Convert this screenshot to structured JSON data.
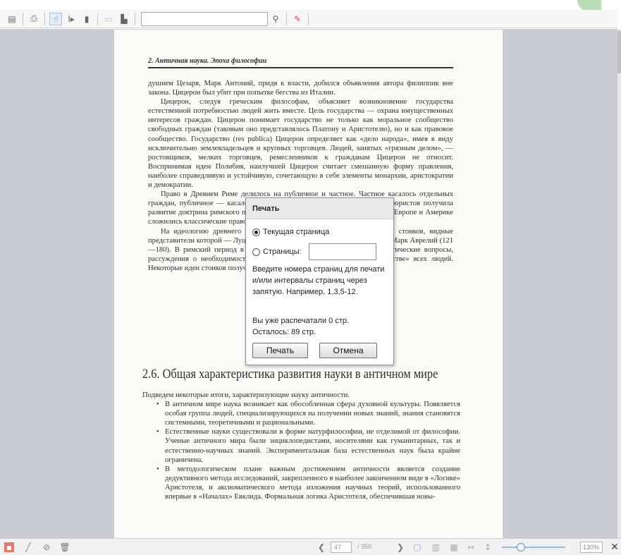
{
  "toolbar": {
    "buttons": [
      "sidebar-icon",
      "print-icon",
      "select-tool-icon",
      "text-select-icon",
      "page-icon",
      "copy-icon",
      "bookmark-icon"
    ],
    "search_icon": "search-icon",
    "highlight_icon": "highlight-icon"
  },
  "page": {
    "running_head": "2. Античная наука. Эпоха философии",
    "paragraphs": [
      "душием Цезаря, Марк Антоний, придя к власти, добился объявления автора филиппик вне закона. Цицерон был убит при попытке бегства из Италии.",
      "Цицерон, следуя греческим философам, объясняет возникновение государства естественной потребностью людей жить вместе. Цель государства — охрана имущественных интересов граждан. Цицерон понимает государство не только как моральное сообщество свободных граждан (таковым оно представлялось Платону и Аристотелю), но и как правовое сообщество. Государство (res publica) Цицерон определяет как «дело народа», имея в виду исключительно землевладельцев и крупных торговцев. Людей, занятых «грязным делом», — ростовщиков, мелких торговцев, ремесленников к гражданам Цицерон не относит. Воспринимая идеи Полибия, наилучшей Цицерон считает смешанную форму правления, наиболее справедливую и устойчивую, сочетающую в себе элементы монархии, аристократии и демократии.",
      "Право в Древнем Риме делилось на публичное и частное. Частное касалось отдельных граждан, публичное — касалось государства в целом. В трудах римских юристов получила развитие доктрина римского права — цивилистики. Позднее на её основе в Европе и Америке сложились классические правовые системы.",
      "На идеологию древнего Рима огромное влияние оказала философия стоиков, видные представители которой — Луций Анней Сенека (ок. 4 г. до н.э. — 65 н.э.) и Марк Аврелий (121—180). В римский период в учении стоиков на первый план выходят этические вопросы, рассуждения о необходимости подчинения судьбе, о «мировом гражданстве» всех людей. Некоторые идеи стоиков получили развитие в христианстве."
    ],
    "section_title": "2.6. Общая характеристика развития науки в античном мире",
    "intro": "Подведем некоторые итоги, характеризующие науку античности.",
    "bullets": [
      "В античном мире наука возникает как обособленная сфера духовной культуры. Появляется особая группа людей, специализирующихся на получении новых знаний, знания становятся системными, теоретичными и рациональными.",
      "Естественные науки существовали в форме натурфилософии, не отделимой от философии. Ученые античного мира были энциклопедистами, носителями как гуманитарных, так и естественно-научных знаний. Экспериментальная база естественных наук была крайне ограничена.",
      "В методологическом плане важным достижением античности является создание дедуктивного метода исследований, закрепленного в наиболее законченном виде в «Логике» Аристотеля, и аксиоматического метода изложения научных теорий, использованного впервые в «Началах» Евклида. Формальная логика Аристотеля, обеспечившая новы-"
    ]
  },
  "dialog": {
    "title": "Печать",
    "option_current": "Текущая страница",
    "option_pages": "Страницы:",
    "hint": "Введите номера страниц для печати и/или интервалы страниц через запятую. Например, 1,3,5-12.",
    "printed": "Вы уже распечатали 0 стр.",
    "remaining": "Осталось: 89 стр.",
    "print_button": "Печать",
    "cancel_button": "Отмена"
  },
  "bottombar": {
    "current_page": "47",
    "total_pages": "/ 350",
    "zoom": "130%",
    "zoom_level_fraction": 0.25,
    "close_glyph": "✕"
  }
}
